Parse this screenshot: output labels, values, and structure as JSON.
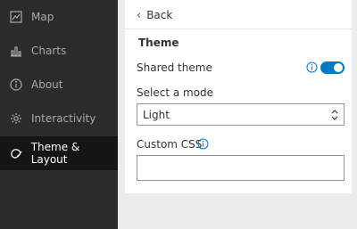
{
  "sidebar": {
    "items": [
      {
        "label": "Map",
        "icon": "map-icon",
        "active": false
      },
      {
        "label": "Charts",
        "icon": "chart-icon",
        "active": false
      },
      {
        "label": "About",
        "icon": "info-icon",
        "active": false
      },
      {
        "label": "Interactivity",
        "icon": "gear-icon",
        "active": false
      },
      {
        "label": "Theme & Layout",
        "icon": "palette-icon",
        "active": true
      }
    ]
  },
  "panel": {
    "back_label": "Back",
    "section_title": "Theme",
    "shared_theme_label": "Shared theme",
    "shared_theme_on": true,
    "mode_label": "Select a mode",
    "mode_value": "Light",
    "custom_css_label": "Custom CSS",
    "custom_css_value": ""
  },
  "colors": {
    "accent": "#007ac2",
    "sidebar_bg": "#2b2b2b",
    "sidebar_active": "#151515"
  }
}
